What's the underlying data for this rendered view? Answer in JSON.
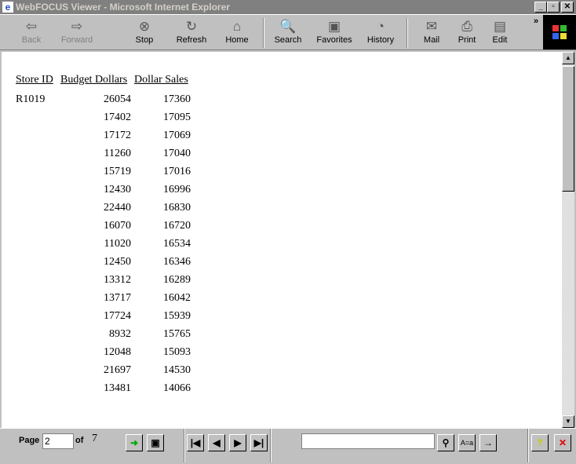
{
  "window": {
    "title": "WebFOCUS Viewer - Microsoft Internet Explorer",
    "min": "_",
    "max": "▫",
    "close": "✕"
  },
  "toolbar": {
    "items": [
      {
        "label": "Back",
        "icon": "⇦",
        "disabled": true
      },
      {
        "label": "Forward",
        "icon": "⇨",
        "disabled": true
      },
      {
        "label": "Stop",
        "icon": "⊗"
      },
      {
        "label": "Refresh",
        "icon": "↻"
      },
      {
        "label": "Home",
        "icon": "⌂"
      },
      {
        "label": "Search",
        "icon": "🔍"
      },
      {
        "label": "Favorites",
        "icon": "▣"
      },
      {
        "label": "History",
        "icon": "◔"
      },
      {
        "label": "Mail",
        "icon": "✉"
      },
      {
        "label": "Print",
        "icon": "⎙"
      },
      {
        "label": "Edit",
        "icon": "▤"
      }
    ],
    "more": "»"
  },
  "report": {
    "headers": [
      "Store ID",
      "Budget Dollars",
      "Dollar Sales"
    ],
    "store_id": "R1019",
    "rows": [
      [
        "26054",
        "17360"
      ],
      [
        "17402",
        "17095"
      ],
      [
        "17172",
        "17069"
      ],
      [
        "11260",
        "17040"
      ],
      [
        "15719",
        "17016"
      ],
      [
        "12430",
        "16996"
      ],
      [
        "22440",
        "16830"
      ],
      [
        "16070",
        "16720"
      ],
      [
        "11020",
        "16534"
      ],
      [
        "12450",
        "16346"
      ],
      [
        "13312",
        "16289"
      ],
      [
        "13717",
        "16042"
      ],
      [
        "17724",
        "15939"
      ],
      [
        "8932",
        "15765"
      ],
      [
        "12048",
        "15093"
      ],
      [
        "21697",
        "14530"
      ],
      [
        "13481",
        "14066"
      ]
    ]
  },
  "pager": {
    "page_label": "Page",
    "page_value": "2",
    "of_label": "of",
    "total": "7",
    "search_value": "",
    "case_label": "A=a",
    "help": "?",
    "close": "✕"
  }
}
